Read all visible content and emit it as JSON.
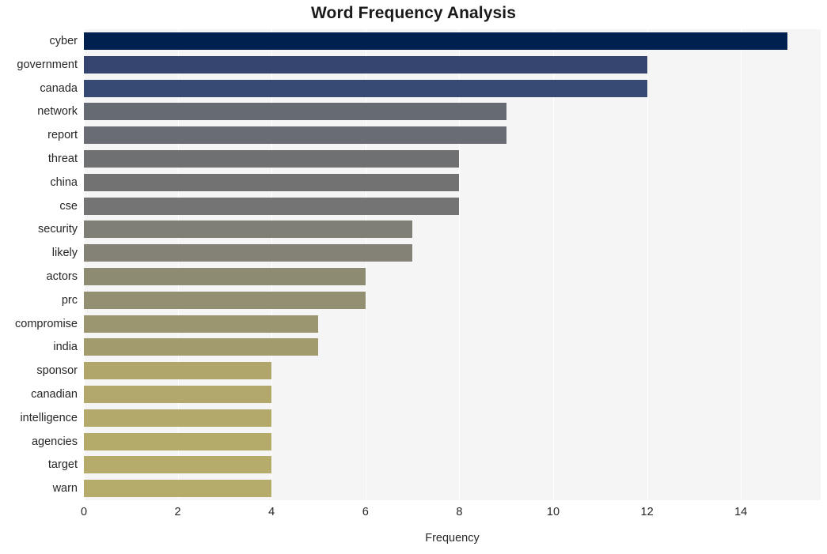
{
  "chart_data": {
    "type": "bar",
    "orientation": "horizontal",
    "title": "Word Frequency Analysis",
    "xlabel": "Frequency",
    "ylabel": "",
    "categories": [
      "cyber",
      "government",
      "canada",
      "network",
      "report",
      "threat",
      "china",
      "cse",
      "security",
      "likely",
      "actors",
      "prc",
      "compromise",
      "india",
      "sponsor",
      "canadian",
      "intelligence",
      "agencies",
      "target",
      "warn"
    ],
    "values": [
      15,
      12,
      12,
      9,
      9,
      8,
      8,
      8,
      7,
      7,
      6,
      6,
      5,
      5,
      4,
      4,
      4,
      4,
      4,
      4
    ],
    "bar_colors": [
      "#002050",
      "#36456f",
      "#374a74",
      "#666a72",
      "#696c73",
      "#6f7071",
      "#737272",
      "#757474",
      "#807f76",
      "#848276",
      "#8e8b73",
      "#928f72",
      "#9b9570",
      "#a29b6e",
      "#b0a66b",
      "#b2a86b",
      "#b3a96a",
      "#b4aa6a",
      "#b5ab6a",
      "#b5ab6a"
    ],
    "xlim": [
      0,
      15.7
    ],
    "xticks": [
      0,
      2,
      4,
      6,
      8,
      10,
      12,
      14
    ],
    "xtick_labels": [
      "0",
      "2",
      "4",
      "6",
      "8",
      "10",
      "12",
      "14"
    ],
    "grid": "vertical-white",
    "plot_background": "#f5f5f5",
    "figure_background": "#ffffff",
    "legend": "none",
    "axis_text_color": "#262626",
    "title_color": "#1a1a1a"
  }
}
